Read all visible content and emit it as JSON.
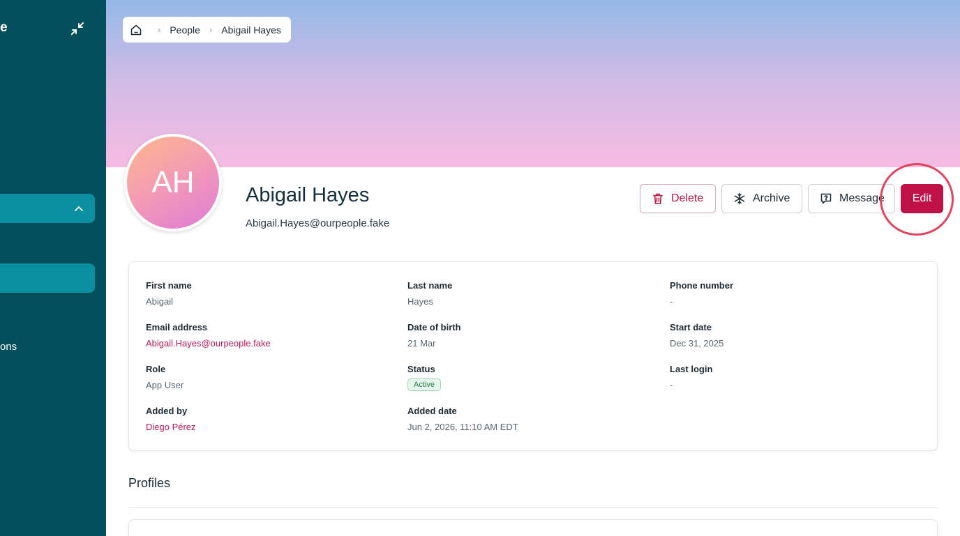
{
  "sidebar": {
    "title_fragment": "e",
    "collapse_icon": "collapse-arrows-icon",
    "item_text_fragment": "ons"
  },
  "breadcrumb": {
    "home_icon": "home-icon",
    "items": [
      "People",
      "Abigail Hayes"
    ]
  },
  "profile": {
    "initials": "AH",
    "name": "Abigail Hayes",
    "email": "Abigail.Hayes@ourpeople.fake"
  },
  "actions": {
    "delete": "Delete",
    "archive": "Archive",
    "message": "Message",
    "edit": "Edit"
  },
  "details": {
    "first_name": {
      "label": "First name",
      "value": "Abigail"
    },
    "last_name": {
      "label": "Last name",
      "value": "Hayes"
    },
    "phone": {
      "label": "Phone number",
      "value": "-"
    },
    "email": {
      "label": "Email address",
      "value": "Abigail.Hayes@ourpeople.fake"
    },
    "dob": {
      "label": "Date of birth",
      "value": "21 Mar"
    },
    "start_date": {
      "label": "Start date",
      "value": "Dec 31, 2025"
    },
    "role": {
      "label": "Role",
      "value": "App User"
    },
    "status": {
      "label": "Status",
      "value": "Active"
    },
    "last_login": {
      "label": "Last login",
      "value": "-"
    },
    "added_by": {
      "label": "Added by",
      "value": "Diego Pérez"
    },
    "added_date": {
      "label": "Added date",
      "value": "Jun 2, 2026, 11:10 AM EDT"
    }
  },
  "profiles_section": {
    "title": "Profiles"
  },
  "colors": {
    "sidebar_bg": "#03505c",
    "sidebar_active": "#0a8fa0",
    "accent": "#c0104a",
    "link": "#b41a5a",
    "status_active": "#237a4a"
  }
}
